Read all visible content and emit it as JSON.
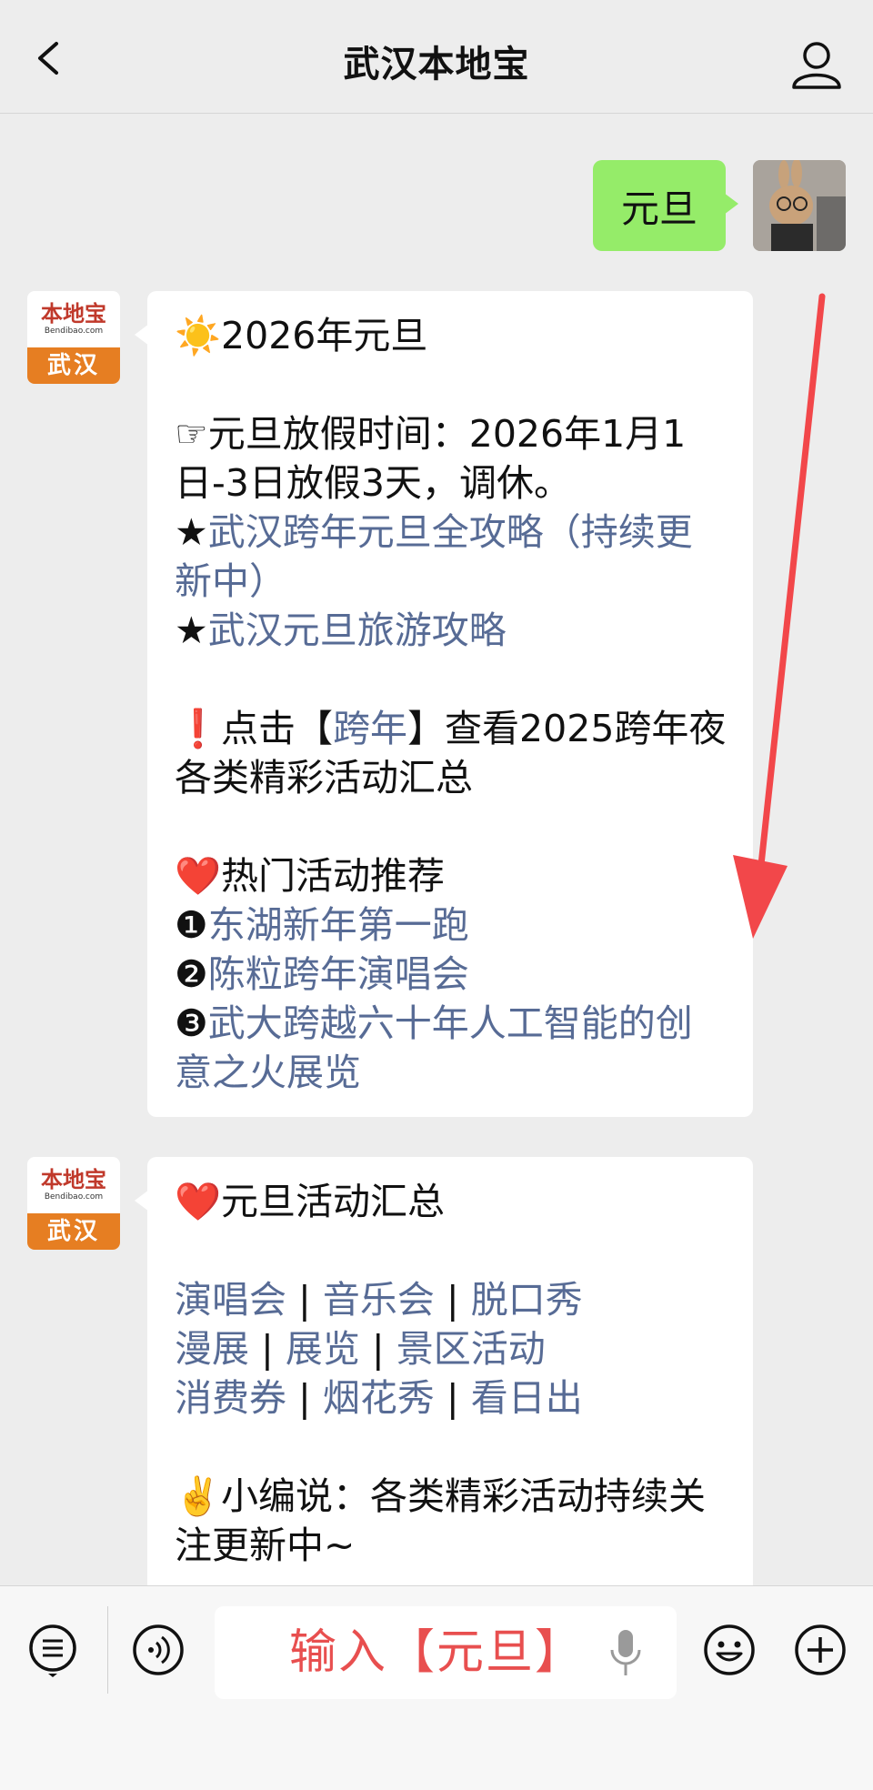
{
  "header": {
    "title": "武汉本地宝"
  },
  "user_message": {
    "text": "元旦"
  },
  "bot": {
    "avatar_brand": "本地宝",
    "avatar_domain": "Bendibao.com",
    "avatar_city": "武汉"
  },
  "message1": {
    "lines": [
      {
        "text": "☀️2026年元旦"
      },
      {
        "text": ""
      },
      {
        "text": "☞元旦放假时间：2026年1月1日-3日放假3天，调休。"
      },
      {
        "prefix": "★",
        "link": "武汉跨年元旦全攻略（持续更新中）"
      },
      {
        "prefix": "★",
        "link": "武汉元旦旅游攻略"
      },
      {
        "text": ""
      },
      {
        "prefix": "❗点击【",
        "link": "跨年",
        "suffix": "】查看2025跨年夜各类精彩活动汇总"
      },
      {
        "text": ""
      },
      {
        "text": "❤️热门活动推荐"
      },
      {
        "prefix": "❶",
        "link": "东湖新年第一跑"
      },
      {
        "prefix": "❷",
        "link": "陈粒跨年演唱会"
      },
      {
        "prefix": "❸",
        "link": "武大跨越六十年人工智能的创意之火展览"
      }
    ]
  },
  "message2": {
    "heading": "❤️元旦活动汇总",
    "link_rows": [
      [
        "演唱会",
        "音乐会",
        "脱口秀"
      ],
      [
        "漫展",
        "展览",
        "景区活动"
      ],
      [
        "消费券",
        "烟花秀",
        "看日出"
      ]
    ],
    "separator": "|",
    "note": "✌️小编说：各类精彩活动持续关注更新中~"
  },
  "input_bar": {
    "text": "输入【元旦】"
  },
  "colors": {
    "link": "#576b95",
    "user_bubble": "#95ec69",
    "input_text": "#e84f4f",
    "arrow": "#f2474a"
  }
}
